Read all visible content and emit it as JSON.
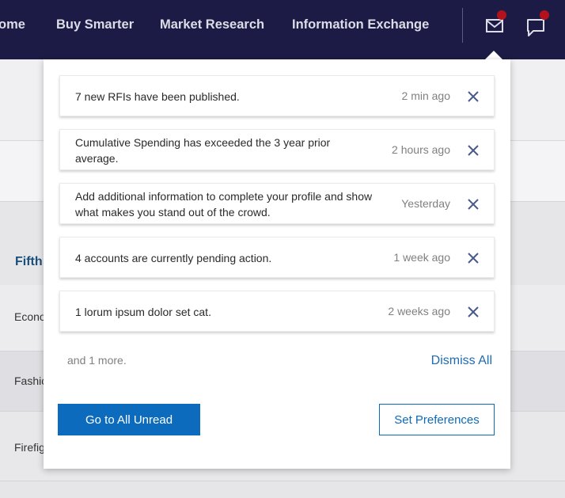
{
  "nav": {
    "items": [
      {
        "label": "ome"
      },
      {
        "label": "Buy Smarter"
      },
      {
        "label": "Market Research"
      },
      {
        "label": "Information Exchange"
      }
    ]
  },
  "background": {
    "heading": "Fifth",
    "rows": [
      {
        "label": "Econo"
      },
      {
        "label": "Fashic"
      },
      {
        "label": "Firefig"
      }
    ]
  },
  "notifications": {
    "items": [
      {
        "message": "7 new RFIs have been published.",
        "time": "2 min ago"
      },
      {
        "message": "Cumulative Spending has exceeded the 3 year prior average.",
        "time": "2 hours ago"
      },
      {
        "message": "Add additional information to complete your profile and show what makes you stand out of the crowd.",
        "time": "Yesterday"
      },
      {
        "message": "4 accounts are currently pending action.",
        "time": "1 week ago"
      },
      {
        "message": "1 lorum ipsum dolor set cat.",
        "time": "2 weeks ago"
      }
    ],
    "more_text": "and 1 more.",
    "dismiss_all_label": "Dismiss All",
    "go_to_unread_label": "Go to All Unread",
    "set_preferences_label": "Set Preferences"
  },
  "icons": {
    "mail": "mail-icon",
    "chat": "chat-icon",
    "close": "close-icon"
  },
  "colors": {
    "nav_bg": "#1b1b45",
    "badge": "#b3121d",
    "primary": "#0c6bbd",
    "link": "#1f6bb4"
  }
}
